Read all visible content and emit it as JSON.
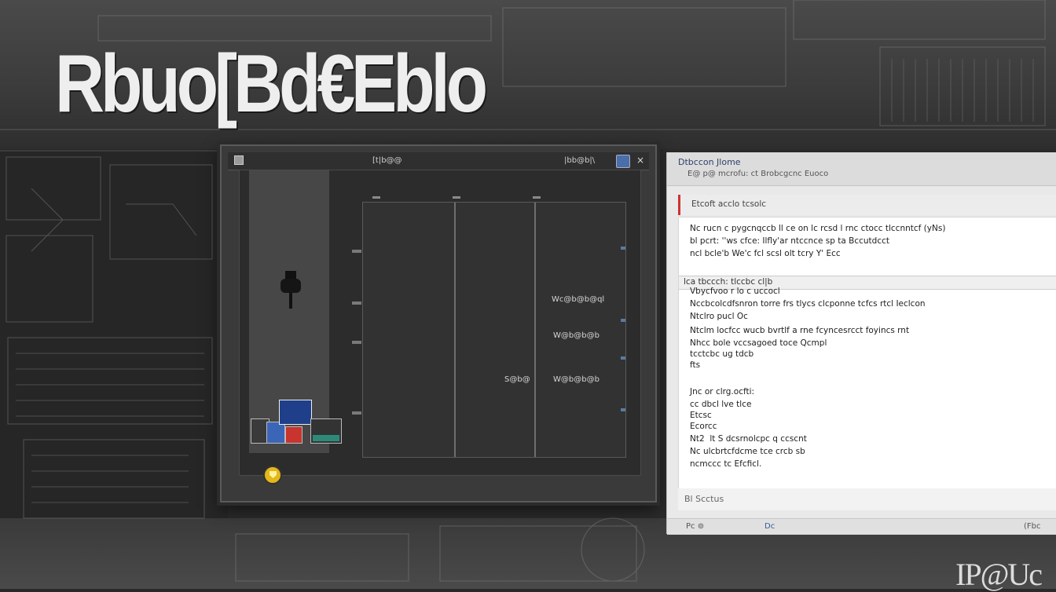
{
  "hero_title": "Rbuo[Bd€Eblo",
  "brand_mark": "IP@Uc",
  "app_window": {
    "title_center": "[t|b@@",
    "title_right": "|bb@b|\\ ",
    "close_glyph": "×",
    "grid_labels": [
      {
        "text": "Wc@b@b@ql"
      },
      {
        "text": "W@b@b@b"
      },
      {
        "text": "W@b@b@b"
      }
    ],
    "left_label": "S@b@"
  },
  "doc_panel": {
    "title": "Dtbccon Jlome",
    "subtitle": "E@ p@ mcrofu: ct Brobcgcnc  Euoco",
    "section_label": "Etcoft acclo tcsolc",
    "paragraph_lines": [
      "Nc rucn c pygcnqccb ll ce on lc rcsd l rnc ctocc tlccnntcf (yNs)",
      "bl pcrt: ''ws cfce: Ilfly'ar ntccnce sp ta Bccutdcct",
      "ncl bcle'b We'c fcl scsl olt tcry Y' Ecc"
    ],
    "subheader": "lca tbccch: tlccbc cl|b",
    "list_lines": [
      "Vbycfvoo r lo c uccocl",
      "Nccbcolcdfsnron torre frs tlycs clcponne tcfcs rtcl Ieclcon",
      "Ntclro pucl Oc",
      "Ntclm locfcc wucb bvrtlf a rne fcyncesrcct foyincs  rnt",
      "Nhcc bole vccsagoed toce Qcmpl",
      "tcctcbc ug tdcb",
      "fts"
    ],
    "block_lines": [
      "Jnc or clrg.ocfti:",
      "cc dbcl lve tlce",
      "Etcsc",
      "Ecorcc",
      "Nt2  lt  S dcsrnolcpc q ccscnt",
      "Nc ulcbrtcfdcme tce crcb sb",
      "ncmccc tc Efcficl."
    ],
    "footer_label": "Bl Scctus",
    "bottom_left": "Pc ⊚",
    "bottom_mid": "Dc",
    "bottom_right": "(Fbc"
  },
  "colors": {
    "doc_accent": "#cc3333",
    "icon_blue": "#3b66b8",
    "icon_red": "#c8342e",
    "shield_yellow": "#e4b71a"
  }
}
